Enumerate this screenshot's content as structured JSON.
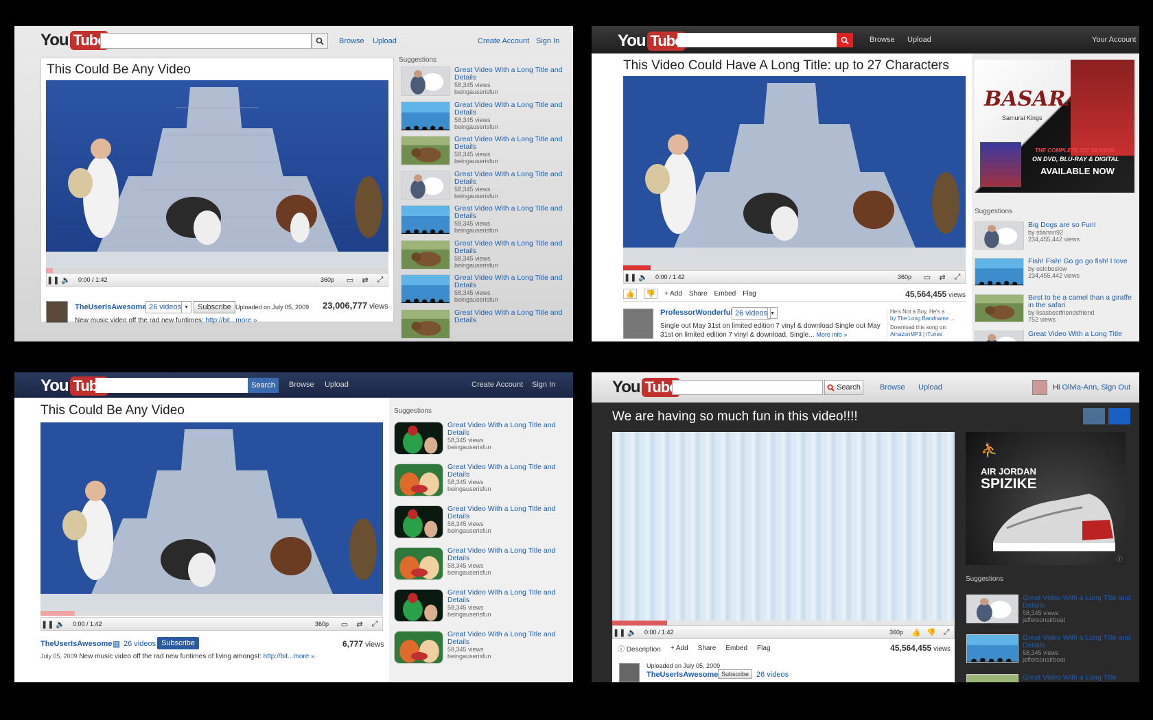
{
  "colors": {
    "yt_red": "#c4302b",
    "link_blue": "#1a5fb4"
  },
  "panel_tl": {
    "logo": {
      "you": "You",
      "tube": "Tube"
    },
    "search": {
      "placeholder": "",
      "icon": "search-icon"
    },
    "nav": {
      "browse": "Browse",
      "upload": "Upload",
      "create_account": "Create Account",
      "sign_in": "Sign In"
    },
    "title": "This Could Be Any Video",
    "player": {
      "time": "0:00 / 1:42",
      "quality": "360p",
      "progress": 0.02
    },
    "channel": {
      "name": "TheUserIsAwesome",
      "videos": "26 videos",
      "subscribe": "Subscribe",
      "uploaded": "Uploaded on July 05, 2009"
    },
    "views_count": "23,006,777",
    "views_label": "views",
    "description": "New music video off the rad new funtimes: ",
    "desc_link": "http://bit...more »",
    "suggestions_label": "Suggestions",
    "suggestions": [
      {
        "title": "Great Video With a Long Title and Details",
        "views": "58,345 views",
        "user": "beingauserisfun",
        "thumb": "dog"
      },
      {
        "title": "Great Video With a Long Title and Details",
        "views": "58,345 views",
        "user": "beingauserisfun",
        "thumb": "aquarium"
      },
      {
        "title": "Great Video With a Long Title and Details",
        "views": "58,345 views",
        "user": "beingauserisfun",
        "thumb": "bear"
      },
      {
        "title": "Great Video With a Long Title and Details",
        "views": "58,345 views",
        "user": "beingauserisfun",
        "thumb": "dog"
      },
      {
        "title": "Great Video With a Long Title and Details",
        "views": "58,345 views",
        "user": "beingauserisfun",
        "thumb": "aquarium"
      },
      {
        "title": "Great Video With a Long Title and Details",
        "views": "58,345 views",
        "user": "beingauserisfun",
        "thumb": "bear"
      },
      {
        "title": "Great Video With a Long Title and Details",
        "views": "58,345 views",
        "user": "beingauserisfun",
        "thumb": "aquarium"
      },
      {
        "title": "Great Video With a Long Title and Details",
        "views": "",
        "user": "",
        "thumb": "bear"
      }
    ]
  },
  "panel_tr": {
    "logo": {
      "you": "You",
      "tube": "Tube"
    },
    "nav": {
      "browse": "Browse",
      "upload": "Upload",
      "account": "Your Account"
    },
    "title": "This Video Could Have A Long Title: up to 27 Characters",
    "player": {
      "time": "0:00 / 1:42",
      "quality": "360p",
      "progress": 0.08
    },
    "actions": {
      "add": "+ Add",
      "share": "Share",
      "embed": "Embed",
      "flag": "Flag"
    },
    "views_count": "45,564,455",
    "views_label": "views",
    "channel": {
      "name": "ProfessorWonderful",
      "videos": "26 videos"
    },
    "description": "Single out May 31st on limited edition 7 vinyl & download Single out May 31st on limited edition 7 vinyl & download. Single...",
    "more_info": "More info »",
    "song": {
      "line1": "He's Not a Boy, He's a ...",
      "line2": "by The Long Bandname ...",
      "line3": "Download this song on:",
      "store1": "AmazonMP3",
      "sep": "|",
      "store2": "iTunes"
    },
    "ad": {
      "title": "BASARA",
      "subtitle": "Samurai Kings",
      "line1": "THE COMPLETE 1ST SEASON",
      "line2": "ON DVD, BLU-RAY & DIGITAL",
      "line3": "AVAILABLE NOW"
    },
    "suggestions_label": "Suggestions",
    "suggestions": [
      {
        "title": "Big Dogs are so Fun!",
        "by": "by stiannn92",
        "views": "234,455,442 views",
        "thumb": "dog"
      },
      {
        "title": "Fish! Fish! Go go go fish! I love",
        "by": "by osloboslow",
        "views": "234,455,442 views",
        "thumb": "aquarium"
      },
      {
        "title": "Best to be a camel than a giraffe in the safari",
        "by": "by lisasbestfriendsfriend",
        "views": "752 views",
        "thumb": "bear"
      },
      {
        "title": "Great Video With a Long Title",
        "by": "",
        "views": "",
        "thumb": "dog"
      }
    ]
  },
  "panel_bl": {
    "logo": {
      "you": "You",
      "tube": "Tube"
    },
    "search": {
      "button": "Search"
    },
    "nav": {
      "browse": "Browse",
      "upload": "Upload",
      "create_account": "Create Account",
      "sign_in": "Sign In"
    },
    "title": "This Could Be Any Video",
    "player": {
      "time": "0:00 / 1:42",
      "quality": "360p",
      "progress": 0.1
    },
    "channel": {
      "name": "TheUserIsAwesome",
      "videos": "26 videos",
      "subscribe": "Subscribe"
    },
    "views_count": "6,777",
    "views_label": "views",
    "date": "July 05, 2009",
    "description": "New music video off the rad new funtimes of living amongst: ",
    "desc_link": "http://bit...more »",
    "suggestions_label": "Suggestions",
    "suggestions": [
      {
        "title": "Great Video With a Long Title and Details",
        "views": "58,345 views",
        "user": "beingauserisfun",
        "thumb": "muppet-dark"
      },
      {
        "title": "Great Video With a Long Title and Details",
        "views": "58,345 views",
        "user": "beingauserisfun",
        "thumb": "muppet-green"
      },
      {
        "title": "Great Video With a Long Title and Details",
        "views": "58,345 views",
        "user": "beingauserisfun",
        "thumb": "muppet-dark"
      },
      {
        "title": "Great Video With a Long Title and Details",
        "views": "58,345 views",
        "user": "beingauserisfun",
        "thumb": "muppet-green"
      },
      {
        "title": "Great Video With a Long Title and Details",
        "views": "58,345 views",
        "user": "beingauserisfun",
        "thumb": "muppet-dark"
      },
      {
        "title": "Great Video With a Long Title and Details",
        "views": "58,345 views",
        "user": "beingauserisfun",
        "thumb": "muppet-green"
      }
    ]
  },
  "panel_br": {
    "logo": {
      "you": "You",
      "tube": "Tube"
    },
    "search": {
      "button": "Search"
    },
    "nav": {
      "browse": "Browse",
      "upload": "Upload",
      "greeting": "Hi",
      "user": "Olivia-Ann",
      "sign_out": "Sign Out"
    },
    "title": "We are having so much fun in this video!!!!",
    "player": {
      "time": "0:00 / 1:42",
      "quality": "360p",
      "progress": 0.16
    },
    "actions": {
      "description": "Description",
      "add": "+ Add",
      "share": "Share",
      "embed": "Embed",
      "flag": "Flag"
    },
    "views_count": "45,564,455",
    "views_label": "views",
    "uploaded": "Uploaded on July 05, 2009",
    "channel": {
      "name": "TheUserIsAwesome",
      "subscribe": "Subscribe",
      "videos": "26 videos"
    },
    "ad": {
      "line1": "AIR JORDAN",
      "line2": "SPIZIKE"
    },
    "suggestions_label": "Suggestions",
    "suggestions": [
      {
        "title": "Great Video With a Long Title and Details",
        "views": "58,345 views",
        "user": "jeffersonairboat",
        "thumb": "dog"
      },
      {
        "title": "Great Video With a Long Title and Details",
        "views": "58,345 views",
        "user": "jeffersonairboat",
        "thumb": "aquarium"
      },
      {
        "title": "Great Video With a Long Title",
        "views": "",
        "user": "",
        "thumb": "bear"
      }
    ]
  }
}
